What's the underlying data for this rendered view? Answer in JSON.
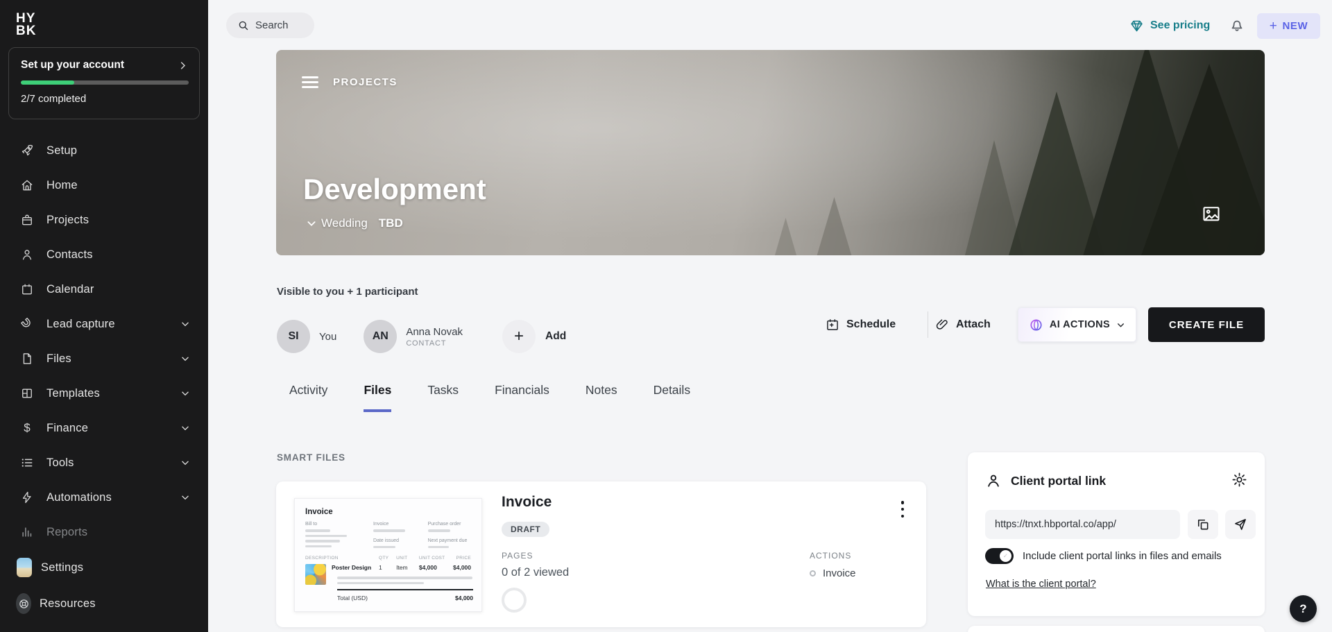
{
  "sidebar": {
    "logo_line1": "HY",
    "logo_line2": "BK",
    "setup_card": {
      "title": "Set up your account",
      "progress_text": "2/7 completed",
      "progress_percent": 32
    },
    "items": [
      {
        "label": "Setup",
        "icon": "rocket-icon"
      },
      {
        "label": "Home",
        "icon": "home-icon"
      },
      {
        "label": "Projects",
        "icon": "briefcase-icon"
      },
      {
        "label": "Contacts",
        "icon": "person-icon"
      },
      {
        "label": "Calendar",
        "icon": "calendar-icon"
      },
      {
        "label": "Lead capture",
        "icon": "magnet-icon",
        "expandable": true
      },
      {
        "label": "Files",
        "icon": "file-icon",
        "expandable": true
      },
      {
        "label": "Templates",
        "icon": "template-icon",
        "expandable": true
      },
      {
        "label": "Finance",
        "icon": "dollar-icon",
        "expandable": true
      },
      {
        "label": "Tools",
        "icon": "list-icon",
        "expandable": true
      },
      {
        "label": "Automations",
        "icon": "bolt-icon",
        "expandable": true
      },
      {
        "label": "Reports",
        "icon": "bar-chart-icon",
        "muted": true
      },
      {
        "label": "Settings",
        "icon": "account-thumbnail"
      },
      {
        "label": "Resources",
        "icon": "lifebuoy-icon"
      }
    ]
  },
  "topbar": {
    "search_placeholder": "Search",
    "see_pricing_label": "See pricing",
    "new_label": "NEW"
  },
  "banner": {
    "section_label": "PROJECTS",
    "title": "Development",
    "project_type": "Wedding",
    "project_date": "TBD"
  },
  "participants": {
    "visibility_text": "Visible to you + 1 participant",
    "members": [
      {
        "initials": "SI",
        "name": "You",
        "role": ""
      },
      {
        "initials": "AN",
        "name": "Anna Novak",
        "role": "CONTACT"
      }
    ],
    "add_label": "Add"
  },
  "action_bar": {
    "schedule_label": "Schedule",
    "attach_label": "Attach",
    "ai_actions_label": "AI ACTIONS",
    "create_file_label": "CREATE FILE"
  },
  "tabs": [
    {
      "label": "Activity",
      "active": false
    },
    {
      "label": "Files",
      "active": true
    },
    {
      "label": "Tasks",
      "active": false
    },
    {
      "label": "Financials",
      "active": false
    },
    {
      "label": "Notes",
      "active": false
    },
    {
      "label": "Details",
      "active": false
    }
  ],
  "smart_files": {
    "section_label": "SMART FILES",
    "card": {
      "title": "Invoice",
      "status": "DRAFT",
      "pages_label": "PAGES",
      "pages_value": "0 of 2 viewed",
      "actions_label": "ACTIONS",
      "action_item": "Invoice",
      "thumbnail": {
        "title": "Invoice",
        "bill_to_label": "Bill to",
        "invoice_label": "Invoice",
        "purchase_order_label": "Purchase order",
        "date_issued_label": "Date issued",
        "next_payment_label": "Next payment due",
        "table_headers": [
          "DESCRIPTION",
          "QTY",
          "UNIT",
          "UNIT COST",
          "PRICE"
        ],
        "line_item": {
          "description": "Poster Design",
          "qty": "1",
          "unit": "Item",
          "unit_cost": "$4,000",
          "price": "$4,000"
        },
        "total_label": "Total (USD)",
        "total_value": "$4,000"
      }
    }
  },
  "client_portal": {
    "title": "Client portal link",
    "url_value": "https://tnxt.hbportal.co/app/",
    "toggle_label": "Include client portal links in files and emails",
    "toggle_state": "on",
    "help_link_label": "What is the client portal?"
  },
  "help_button": {
    "label": "?"
  },
  "colors": {
    "sidebar_bg": "#1a1a1b",
    "page_bg": "#f4f5f7",
    "accent_green": "#3ecf78",
    "teal": "#187e8a",
    "indigo": "#5b63e6",
    "new_button_bg": "#e3e4f9",
    "tab_underline": "#5b68c8",
    "black_button": "#17181b"
  }
}
